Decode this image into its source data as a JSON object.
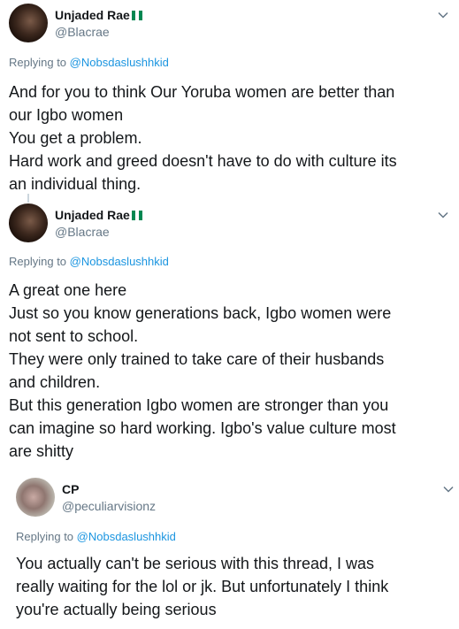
{
  "tweets": [
    {
      "name": "Unjaded Rae",
      "flag_colors": [
        "#008751",
        "#ffffff",
        "#008751"
      ],
      "handle": "@Blacrae",
      "replying_prefix": "Replying to",
      "replying_to": "@Nobsdaslushhkid",
      "lines": [
        "And for you to think Our Yoruba women are better than",
        "our Igbo women",
        "You get a problem.",
        "Hard work and greed doesn't have to do with culture its",
        "an individual thing."
      ]
    },
    {
      "name": "Unjaded Rae",
      "flag_colors": [
        "#008751",
        "#ffffff",
        "#008751"
      ],
      "handle": "@Blacrae",
      "replying_prefix": "Replying to",
      "replying_to": "@Nobsdaslushhkid",
      "lines": [
        "A great one here",
        "Just so you know generations back, Igbo women were",
        "not sent to school.",
        "They were only trained to take care of their husbands",
        "and children.",
        "But this generation Igbo women are stronger than you",
        "can imagine so hard working. Igbo's value culture most",
        "are shitty"
      ]
    },
    {
      "name": "CP",
      "handle": "@peculiarvisionz",
      "replying_prefix": "Replying to",
      "replying_to": "@Nobsdaslushhkid",
      "lines": [
        "You actually can't be serious with this thread, I was",
        "really waiting for the lol or jk. But unfortunately I think",
        "you're actually being serious"
      ]
    }
  ],
  "colors": {
    "name": "#14171a",
    "secondary": "#657786",
    "link": "#1b95e0"
  }
}
